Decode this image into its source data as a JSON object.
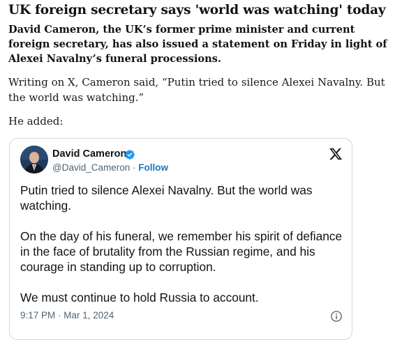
{
  "article": {
    "headline": "UK foreign secretary says 'world was watching' today",
    "standfirst": "David Cameron, the UK’s former prime minister and current foreign secretary, has also issued a statement on Friday in light of Alexei Navalny’s funeral processions.",
    "paragraph1": "Writing on X, Cameron said, “Putin tried to silence Alexei Navalny. But the world was watching.”",
    "paragraph2": "He added:"
  },
  "tweet": {
    "author_name": "David Cameron",
    "handle": "@David_Cameron",
    "separator": "·",
    "follow_label": "Follow",
    "body": [
      "Putin tried to silence Alexei Navalny. But the world was watching.",
      "On the day of his funeral, we remember his spirit of defiance in the face of brutality from the Russian regime, and his courage in standing up to corruption.",
      "We must continue to hold Russia to account."
    ],
    "timestamp": "9:17 PM · Mar 1, 2024",
    "icons": {
      "verified": "verified-badge-icon",
      "platform": "x-logo-icon",
      "info": "info-icon"
    }
  },
  "colors": {
    "link_blue": "#1d77bd",
    "verified_blue": "#1d9bf0",
    "muted_text": "#536471"
  }
}
